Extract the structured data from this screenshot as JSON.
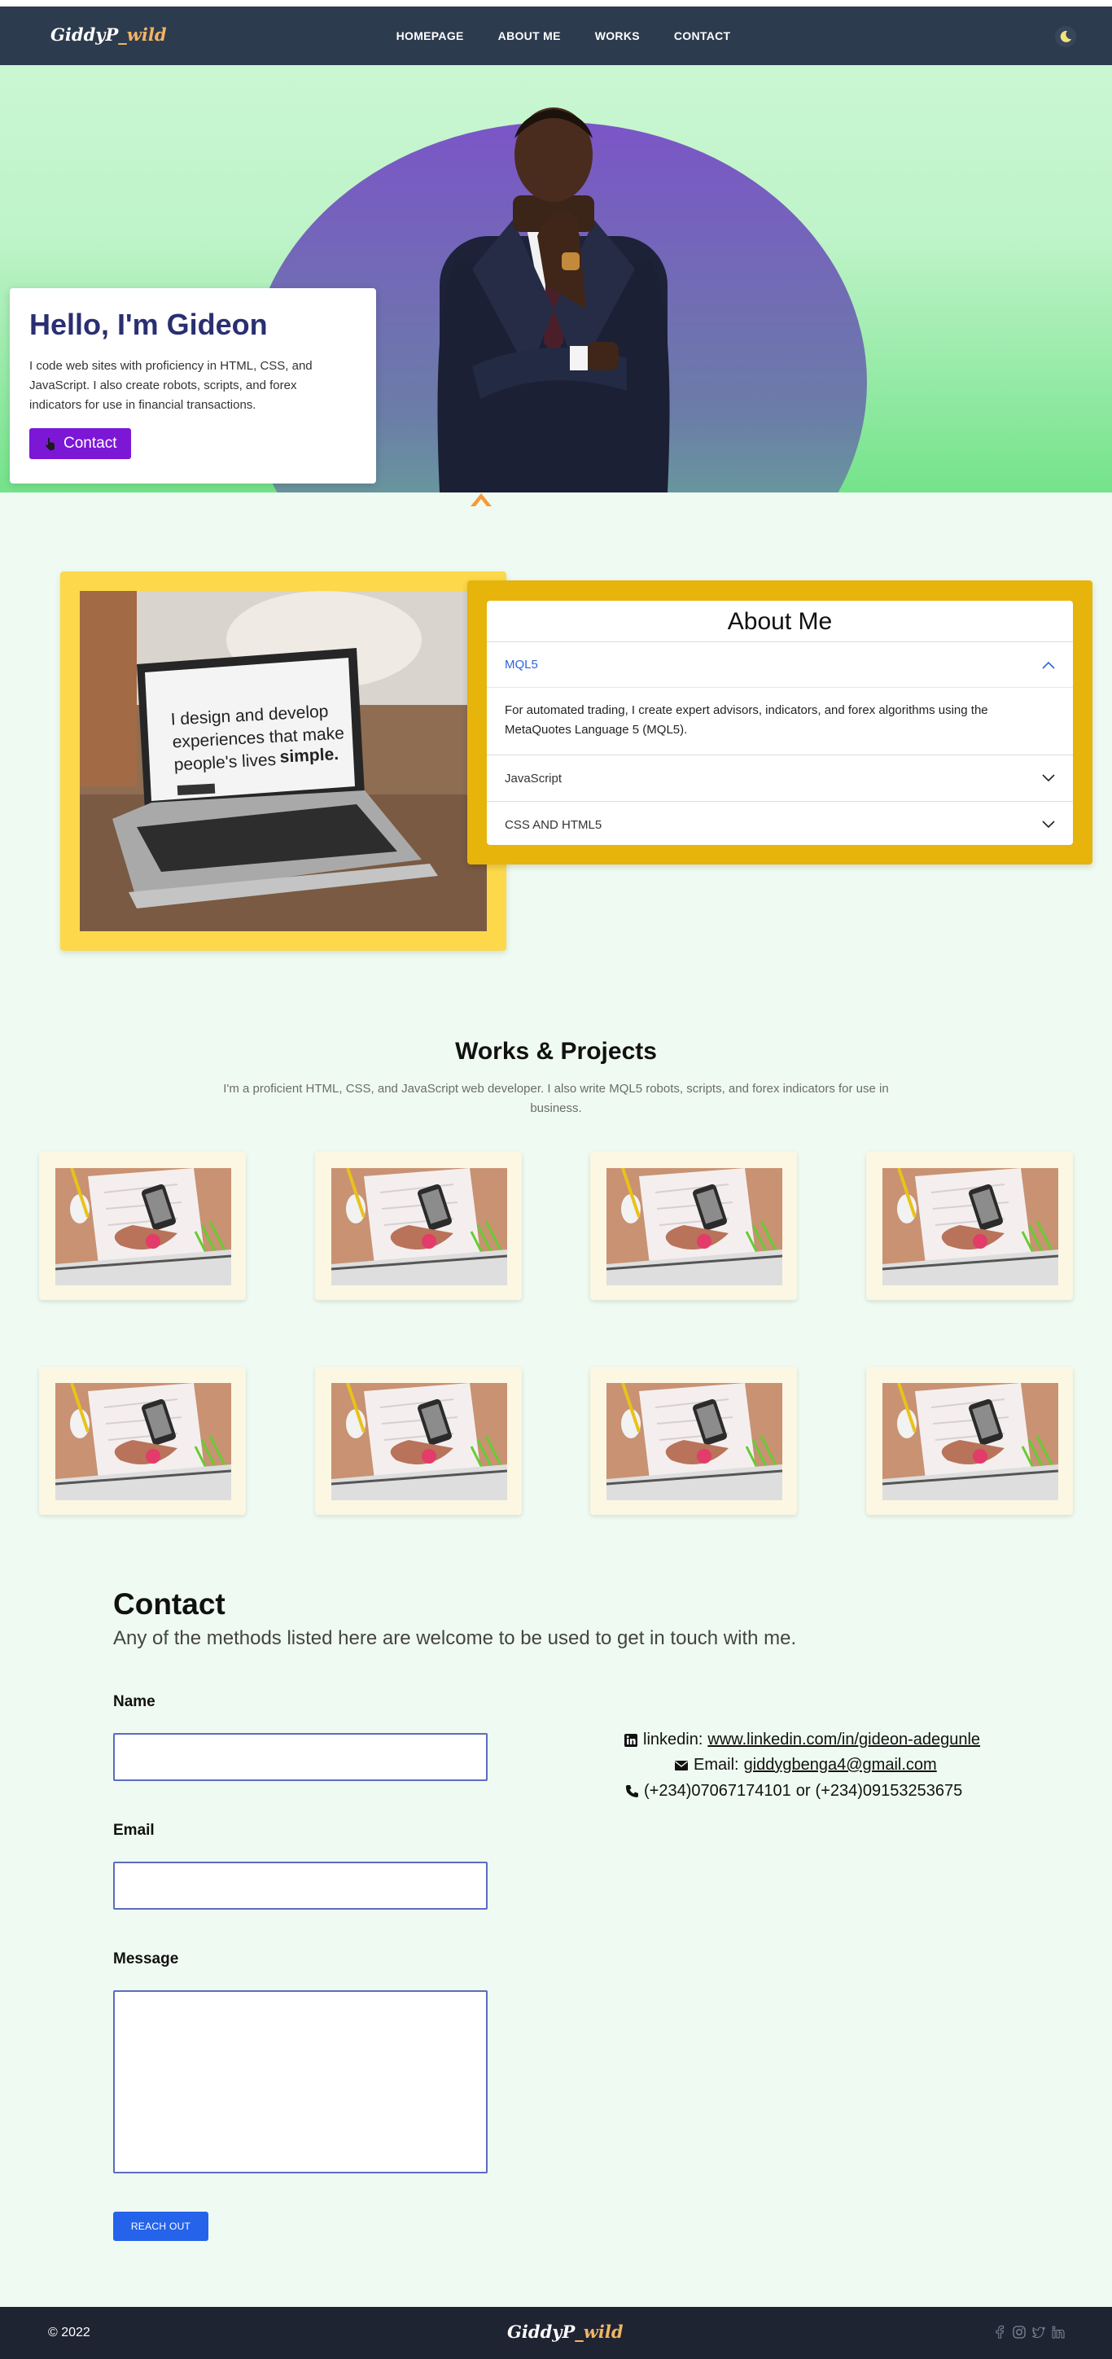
{
  "brand": {
    "logo_main": "GiddyP",
    "logo_accent": "_wild"
  },
  "nav": {
    "links": [
      "HOMEPAGE",
      "ABOUT ME",
      "WORKS",
      "CONTACT"
    ]
  },
  "hero": {
    "title": "Hello, I'm Gideon",
    "text": "I code web sites with proficiency in HTML, CSS, and JavaScript. I also create robots, scripts, and forex indicators for use in financial transactions.",
    "button_label": "Contact"
  },
  "about": {
    "image_text_line1": "I design and develop",
    "image_text_line2": "experiences that make",
    "image_text_line3_a": "people's lives",
    "image_text_line3_b": "simple.",
    "title": "About Me",
    "items": [
      {
        "label": "MQL5",
        "expanded": true,
        "body": "For automated trading, I create expert advisors, indicators, and forex algorithms using the MetaQuotes Language 5 (MQL5)."
      },
      {
        "label": "JavaScript",
        "expanded": false
      },
      {
        "label": "CSS AND HTML5",
        "expanded": false
      }
    ]
  },
  "works": {
    "title": "Works & Projects",
    "subtitle": "I'm a proficient HTML, CSS, and JavaScript web developer. I also write MQL5 robots, scripts, and forex indicators for use in business.",
    "project_count": 8
  },
  "contact": {
    "title": "Contact",
    "subtitle": "Any of the methods listed here are welcome to be used to get in touch with me.",
    "name_label": "Name",
    "email_label": "Email",
    "message_label": "Message",
    "name_value": "",
    "email_value": "",
    "message_value": "",
    "button_label": "REACH OUT",
    "linkedin_label": "linkedin:",
    "linkedin_url": "www.linkedin.com/in/gideon-adegunle",
    "email_text_label": "Email:",
    "email_address": "giddygbenga4@gmail.com",
    "phone1": "(+234)07067174101",
    "phone_or": "or",
    "phone2": "(+234)09153253675"
  },
  "footer": {
    "copyright": "© 2022"
  },
  "colors": {
    "nav_bg": "#2d3b4f",
    "hero_title": "#2a2f72",
    "contact_button": "#7c17d6",
    "about_left": "#fdd84a",
    "about_right": "#e7b40c",
    "accordion_active": "#2c64d8",
    "reach_button": "#2563eb",
    "footer_bg": "#1f2433"
  },
  "icons": [
    "moon-icon",
    "hand-icon",
    "chevron-up-icon",
    "chevron-down-icon",
    "linkedin-icon",
    "mail-icon",
    "phone-icon",
    "facebook-icon",
    "instagram-icon",
    "twitter-icon",
    "linkedin-footer-icon"
  ]
}
